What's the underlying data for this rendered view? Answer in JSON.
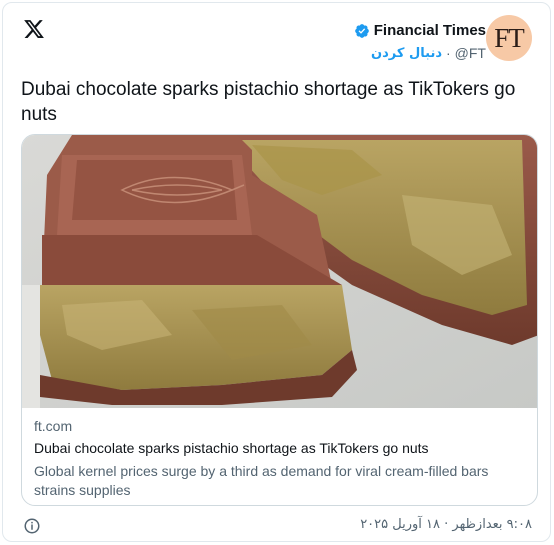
{
  "tweet": {
    "author": {
      "name": "Financial Times",
      "handle": "@FT",
      "follow_label": "دنبال کردن",
      "separator": "·",
      "avatar_text": "FT"
    },
    "text": "Dubai chocolate sparks pistachio shortage as TikTokers go nuts",
    "link_card": {
      "domain": "ft.com",
      "title": "Dubai chocolate sparks pistachio shortage as TikTokers go nuts",
      "description": "Global kernel prices surge by a third as demand for viral cream-filled bars strains supplies"
    },
    "timestamp": "۹:۰۸ بعدازظهر · ۱۸ آوریل ۲۰۲۵"
  },
  "icons": {
    "platform": "x-logo-icon",
    "verified": "verified-badge-icon",
    "info": "info-icon"
  },
  "colors": {
    "accent": "#1d9bf0",
    "avatar_bg": "#f7c9a6",
    "secondary_text": "#536471"
  }
}
